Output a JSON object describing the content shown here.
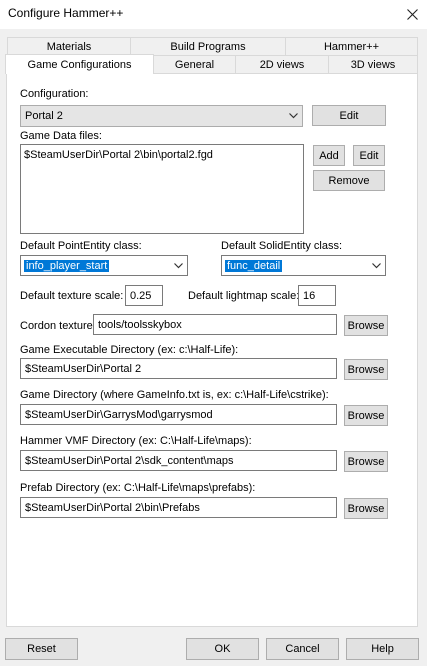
{
  "window": {
    "title": "Configure Hammer++"
  },
  "tabs_row1": [
    "Materials",
    "Build Programs",
    "Hammer++"
  ],
  "tabs_row2": [
    "Game Configurations",
    "General",
    "2D views",
    "3D views"
  ],
  "configuration": {
    "label": "Configuration:",
    "selected": "Portal 2",
    "edit_label": "Edit"
  },
  "game_data": {
    "label": "Game Data files:",
    "files": [
      "$SteamUserDir\\Portal 2\\bin\\portal2.fgd"
    ],
    "add_label": "Add",
    "edit_label": "Edit",
    "remove_label": "Remove"
  },
  "point_entity": {
    "label": "Default PointEntity class:",
    "selected": "info_player_start"
  },
  "solid_entity": {
    "label": "Default SolidEntity class:",
    "selected": "func_detail"
  },
  "texture_scale": {
    "label": "Default texture scale:",
    "value": "0.25"
  },
  "lightmap_scale": {
    "label": "Default lightmap scale:",
    "value": "16"
  },
  "cordon": {
    "label": "Cordon texture:",
    "value": "tools/toolsskybox",
    "browse_label": "Browse"
  },
  "game_exe_dir": {
    "label": "Game Executable Directory (ex: c:\\Half-Life):",
    "value": "$SteamUserDir\\Portal 2",
    "browse_label": "Browse"
  },
  "game_dir": {
    "label": "Game Directory (where GameInfo.txt is, ex: c:\\Half-Life\\cstrike):",
    "value": "$SteamUserDir\\GarrysMod\\garrysmod",
    "browse_label": "Browse"
  },
  "vmf_dir": {
    "label": "Hammer VMF Directory (ex: C:\\Half-Life\\maps):",
    "value": "$SteamUserDir\\Portal 2\\sdk_content\\maps",
    "browse_label": "Browse"
  },
  "prefab_dir": {
    "label": "Prefab Directory (ex: C:\\Half-Life\\maps\\prefabs):",
    "value": "$SteamUserDir\\Portal 2\\bin\\Prefabs",
    "browse_label": "Browse"
  },
  "footer": {
    "reset_label": "Reset",
    "ok_label": "OK",
    "cancel_label": "Cancel",
    "help_label": "Help"
  },
  "icons": {
    "close": "close-icon",
    "dropdown": "chevron-down-icon"
  }
}
